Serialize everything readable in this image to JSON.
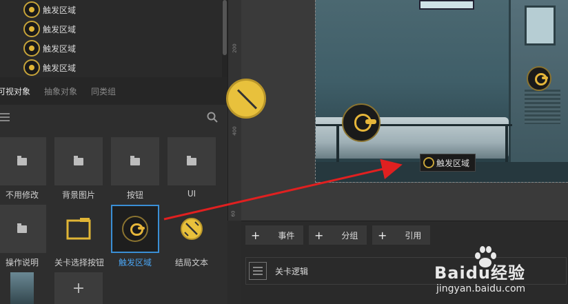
{
  "tree": {
    "items": [
      {
        "label": "触发区域"
      },
      {
        "label": "触发区域"
      },
      {
        "label": "触发区域"
      },
      {
        "label": "触发区域"
      }
    ]
  },
  "tabs": [
    {
      "label": "可视对象",
      "active": true
    },
    {
      "label": "抽象对象",
      "active": false
    },
    {
      "label": "同类组",
      "active": false
    }
  ],
  "assets": [
    {
      "label": "不用修改",
      "icon": "folder-icon"
    },
    {
      "label": "背景图片",
      "icon": "folder-icon"
    },
    {
      "label": "按钮",
      "icon": "folder-icon"
    },
    {
      "label": "UI",
      "icon": "folder-icon"
    },
    {
      "label": "操作说明",
      "icon": "folder-icon"
    },
    {
      "label": "关卡选择按钮",
      "icon": "level-select-icon"
    },
    {
      "label": "触发区域",
      "icon": "trigger-area-icon",
      "selected": true
    },
    {
      "label": "结局文本",
      "icon": "ending-text-icon"
    }
  ],
  "ruler": {
    "marks": [
      "200",
      "400",
      "60"
    ]
  },
  "canvas": {
    "trigger_tag": "触发区域"
  },
  "bottom": {
    "buttons": [
      {
        "plus": "+",
        "label": "事件"
      },
      {
        "plus": "+",
        "label": "分组"
      },
      {
        "plus": "+",
        "label": "引用"
      }
    ],
    "logic_label": "关卡逻辑"
  },
  "add_tile": "+",
  "watermark": {
    "brand": "Baidu经验",
    "url": "jingyan.baidu.com"
  },
  "colors": {
    "accent_blue": "#3a8fd6",
    "arrow_red": "#e02020",
    "gold": "#e6b63a"
  }
}
